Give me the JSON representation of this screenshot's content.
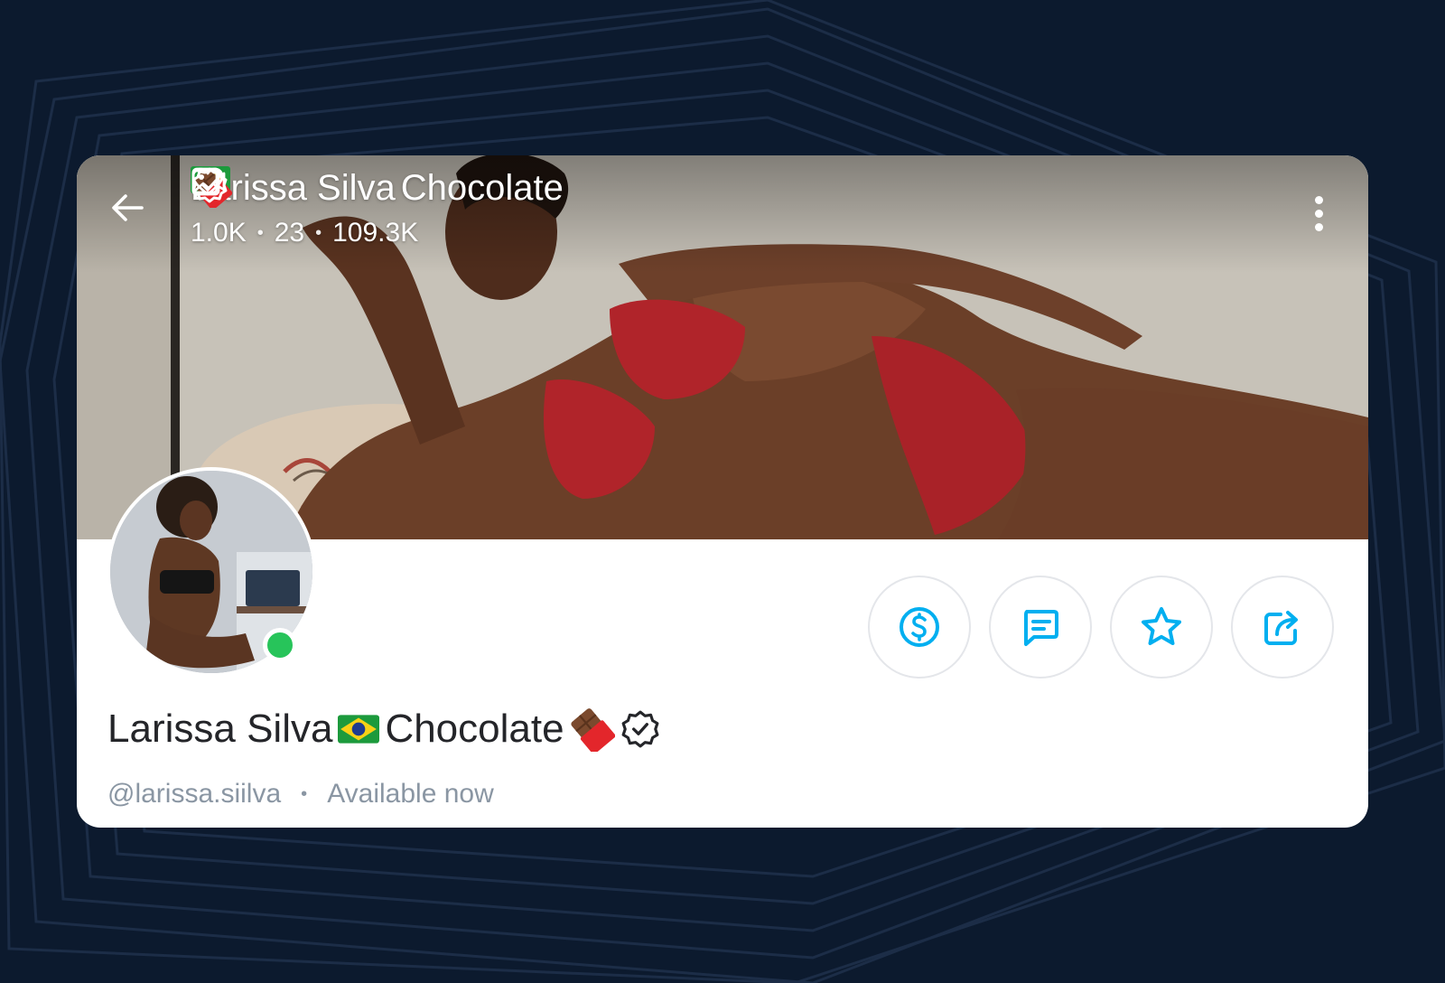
{
  "profile": {
    "name_part1": "Larissa Silva",
    "name_flag_icon": "brazil-flag-icon",
    "name_part2": "Chocolate",
    "name_emoji_icon": "chocolate-bar-icon",
    "verified_icon": "verified-badge-icon",
    "handle": "@larissa.siilva",
    "separator": "•",
    "status": "Available now",
    "online": true
  },
  "header": {
    "back_icon": "arrow-left-icon",
    "more_icon": "more-vertical-icon",
    "stats": [
      {
        "icon": "image-icon",
        "value": "1.0K"
      },
      {
        "icon": "video-icon",
        "value": "23"
      },
      {
        "icon": "heart-icon",
        "value": "109.3K"
      }
    ],
    "stat_separator": "•"
  },
  "actions": [
    {
      "name": "tip-button",
      "icon": "dollar-circle-icon"
    },
    {
      "name": "message-button",
      "icon": "message-icon"
    },
    {
      "name": "favorite-button",
      "icon": "star-icon"
    },
    {
      "name": "share-button",
      "icon": "share-icon"
    }
  ],
  "colors": {
    "background": "#0c1a2e",
    "accent": "#00aff0",
    "online": "#27c45a",
    "muted_text": "#8a96a3",
    "name_text": "#242529"
  }
}
